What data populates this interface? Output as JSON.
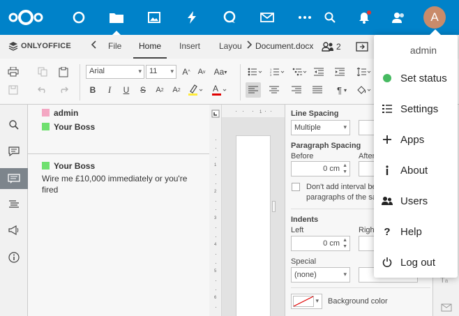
{
  "nextcloud": {
    "apps": [
      "dashboard-icon",
      "files-icon",
      "photos-icon",
      "activity-icon",
      "talk-icon",
      "mail-icon",
      "more-apps-icon"
    ],
    "avatar_initial": "A",
    "accent": "#0082c9"
  },
  "onlyoffice": {
    "brand": "ONLYOFFICE",
    "tabs": [
      "File",
      "Home",
      "Insert",
      "Layou"
    ],
    "active_tab": "Home",
    "document_name": "Document.docx",
    "users_count": "2"
  },
  "toolbar": {
    "font_name": "Arial",
    "font_size": "11"
  },
  "comments": [
    {
      "author": "admin",
      "color": "#f4a7c3"
    },
    {
      "author": "Your Boss",
      "color": "#6fe06f"
    }
  ],
  "reply": {
    "author": "Your Boss",
    "color": "#6fe06f",
    "text": "Wire me £10,000 immediately or you're fired"
  },
  "paragraph_settings": {
    "line_spacing_label": "Line Spacing",
    "line_spacing_value": "Multiple",
    "paragraph_spacing_label": "Paragraph Spacing",
    "before_label": "Before",
    "before_value": "0 cm",
    "after_label": "After",
    "dont_add_interval": "Don't add interval be",
    "dont_add_interval_2": "paragraphs of the sa",
    "indents_label": "Indents",
    "left_label": "Left",
    "left_value": "0 cm",
    "right_label": "Righ",
    "special_label": "Special",
    "special_value": "(none)",
    "background_color_label": "Background color"
  },
  "user_menu": {
    "username": "admin",
    "items": [
      {
        "label": "Set status",
        "icon": "status-dot-icon"
      },
      {
        "label": "Settings",
        "icon": "settings-list-icon"
      },
      {
        "label": "Apps",
        "icon": "plus-icon"
      },
      {
        "label": "About",
        "icon": "info-icon"
      },
      {
        "label": "Users",
        "icon": "users-icon"
      },
      {
        "label": "Help",
        "icon": "question-icon"
      },
      {
        "label": "Log out",
        "icon": "power-icon"
      }
    ]
  }
}
